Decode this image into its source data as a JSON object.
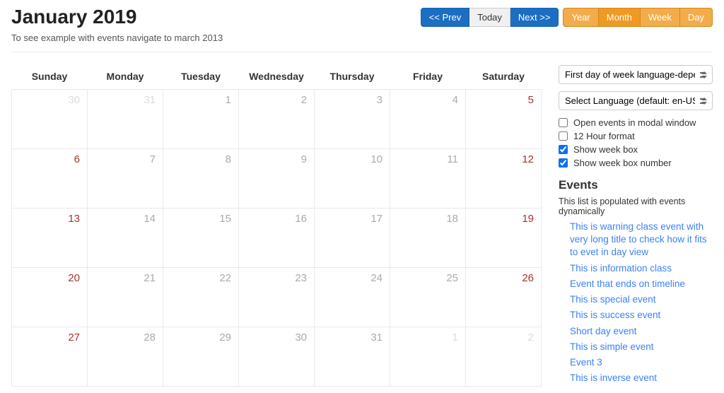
{
  "header": {
    "title": "January 2019",
    "subtitle": "To see example with events navigate to march 2013",
    "nav": {
      "prev": "<< Prev",
      "today": "Today",
      "next": "Next >>"
    },
    "views": {
      "year": "Year",
      "month": "Month",
      "week": "Week",
      "day": "Day"
    }
  },
  "calendar": {
    "day_headers": [
      "Sunday",
      "Monday",
      "Tuesday",
      "Wednesday",
      "Thursday",
      "Friday",
      "Saturday"
    ],
    "weeks": [
      [
        {
          "n": 30,
          "other": true,
          "weekend": true
        },
        {
          "n": 31,
          "other": true
        },
        {
          "n": 1
        },
        {
          "n": 2
        },
        {
          "n": 3
        },
        {
          "n": 4
        },
        {
          "n": 5,
          "weekend": true
        }
      ],
      [
        {
          "n": 6,
          "weekend": true
        },
        {
          "n": 7
        },
        {
          "n": 8
        },
        {
          "n": 9
        },
        {
          "n": 10
        },
        {
          "n": 11
        },
        {
          "n": 12,
          "weekend": true
        }
      ],
      [
        {
          "n": 13,
          "weekend": true
        },
        {
          "n": 14
        },
        {
          "n": 15
        },
        {
          "n": 16
        },
        {
          "n": 17
        },
        {
          "n": 18
        },
        {
          "n": 19,
          "weekend": true
        }
      ],
      [
        {
          "n": 20,
          "weekend": true
        },
        {
          "n": 21
        },
        {
          "n": 22
        },
        {
          "n": 23
        },
        {
          "n": 24
        },
        {
          "n": 25
        },
        {
          "n": 26,
          "weekend": true
        }
      ],
      [
        {
          "n": 27,
          "weekend": true
        },
        {
          "n": 28
        },
        {
          "n": 29
        },
        {
          "n": 30
        },
        {
          "n": 31
        },
        {
          "n": 1,
          "other": true
        },
        {
          "n": 2,
          "other": true,
          "weekend": true
        }
      ]
    ]
  },
  "sidebar": {
    "first_day_selected": "First day of week language-dependant",
    "language_selected": "Select Language (default: en-US)",
    "options": {
      "modal": {
        "label": "Open events in modal window",
        "checked": false
      },
      "hour12": {
        "label": "12 Hour format",
        "checked": false
      },
      "weekbox": {
        "label": "Show week box",
        "checked": true
      },
      "weekboxnum": {
        "label": "Show week box number",
        "checked": true
      }
    },
    "events_heading": "Events",
    "events_desc": "This list is populated with events dynamically",
    "events": [
      "This is warning class event with very long title to check how it fits to evet in day view",
      "This is information class",
      "Event that ends on timeline",
      "This is special event",
      "This is success event",
      "Short day event",
      "This is simple event",
      "Event 3",
      "This is inverse event"
    ]
  }
}
